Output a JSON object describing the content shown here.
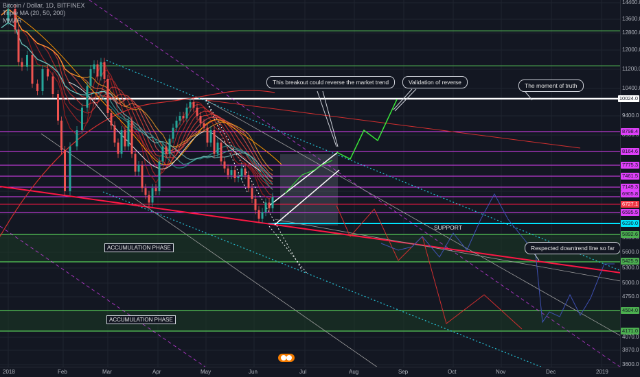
{
  "header": {
    "symbol_line": "Bitcoin / Dollar, 1D, BITFINEX",
    "indicator_line": "Triple MA (20, 50, 200)",
    "indicator_line2": "MMAR"
  },
  "colors": {
    "background": "#131722",
    "up_candle": "#26a69a",
    "down_candle": "#ef5350",
    "magenta_level": "#e040fb",
    "green_level": "#4caf50",
    "support_level": "#00e5ff",
    "resistance_white": "#ffffff",
    "trendline_red": "#ff1744",
    "projection_green": "#39e639",
    "projection_blue": "#3f51b5"
  },
  "annotations": {
    "breakout_callout": "This breakout could reverse the market trend",
    "validation_callout": "Validation of reverse",
    "truth_callout": "The moment of truth",
    "downtrend_callout": "Respected downtrend line so far",
    "support_label": "SUPPORT",
    "accumulation_1": "ACCUMULATION PHASE",
    "accumulation_2": "ACCUMULATION PHASE"
  },
  "chart_data": {
    "type": "line",
    "x_axis_labels": [
      "2018",
      "Feb",
      "Mar",
      "Apr",
      "May",
      "Jun",
      "Jul",
      "Aug",
      "Sep",
      "Oct",
      "Nov",
      "Dec",
      "2019"
    ],
    "price_axis_labels": [
      "14400.0",
      "13600.0",
      "12800.0",
      "12000.0",
      "11200.0",
      "10400.0",
      "9400.0",
      "8600.0",
      "7800.0",
      "7000.0",
      "6400.0",
      "5900.0",
      "5600.0",
      "5300.0",
      "5000.0",
      "4750.0",
      "4400.0",
      "4070.0",
      "3870.0",
      "3600.0"
    ],
    "price_tags": [
      {
        "label": "10024.0",
        "bg": "#ffffff",
        "fg": "#131722"
      },
      {
        "label": "8798.4",
        "bg": "#e040fb",
        "fg": "#131722"
      },
      {
        "label": "8164.6",
        "bg": "#e040fb",
        "fg": "#131722"
      },
      {
        "label": "7775.3",
        "bg": "#e040fb",
        "fg": "#131722"
      },
      {
        "label": "7461.5",
        "bg": "#e040fb",
        "fg": "#131722"
      },
      {
        "label": "7149.3",
        "bg": "#e040fb",
        "fg": "#131722"
      },
      {
        "label": "6905.8",
        "bg": "#e040fb",
        "fg": "#131722"
      },
      {
        "label": "6727.1",
        "bg": "#f23645",
        "fg": "#ffffff"
      },
      {
        "label": "6595.5",
        "bg": "#e040fb",
        "fg": "#131722"
      },
      {
        "label": "6230.0",
        "bg": "#00e5ff",
        "fg": "#131722"
      },
      {
        "label": "5892.6",
        "bg": "#4caf50",
        "fg": "#131722"
      },
      {
        "label": "5425.9",
        "bg": "#4caf50",
        "fg": "#131722"
      },
      {
        "label": "4504.0",
        "bg": "#4caf50",
        "fg": "#131722"
      },
      {
        "label": "4171.0",
        "bg": "#4caf50",
        "fg": "#131722"
      }
    ],
    "series": [
      {
        "name": "",
        "values": [
          [
            0,
            13500
          ],
          [
            4,
            14100
          ],
          [
            8,
            13000
          ],
          [
            10,
            11500
          ],
          [
            12,
            11300
          ],
          [
            15,
            11800
          ],
          [
            18,
            10600
          ],
          [
            21,
            10300
          ],
          [
            24,
            11200
          ],
          [
            27,
            10900
          ],
          [
            30,
            10200
          ],
          [
            33,
            9200
          ],
          [
            35,
            8200
          ],
          [
            37,
            7000
          ],
          [
            40,
            8300
          ],
          [
            44,
            8800
          ],
          [
            47,
            9700
          ],
          [
            50,
            10500
          ],
          [
            52,
            11200
          ],
          [
            54,
            11400
          ],
          [
            56,
            10900
          ],
          [
            58,
            11500
          ],
          [
            60,
            10800
          ],
          [
            62,
            9500
          ],
          [
            64,
            9000
          ],
          [
            66,
            8400
          ],
          [
            68,
            8100
          ],
          [
            70,
            8800
          ],
          [
            72,
            8300
          ],
          [
            74,
            9200
          ],
          [
            76,
            8100
          ],
          [
            78,
            7600
          ],
          [
            80,
            7800
          ],
          [
            82,
            7100
          ],
          [
            84,
            6900
          ],
          [
            86,
            6700
          ],
          [
            88,
            7100
          ],
          [
            90,
            7000
          ],
          [
            92,
            7900
          ],
          [
            94,
            8300
          ],
          [
            96,
            8100
          ],
          [
            98,
            8500
          ],
          [
            100,
            8900
          ],
          [
            102,
            9200
          ],
          [
            104,
            9400
          ],
          [
            106,
            9300
          ],
          [
            108,
            9700
          ],
          [
            110,
            9900
          ],
          [
            112,
            9700
          ],
          [
            114,
            9400
          ],
          [
            116,
            9100
          ],
          [
            118,
            8900
          ],
          [
            120,
            8400
          ],
          [
            122,
            8800
          ],
          [
            124,
            8100
          ],
          [
            126,
            8400
          ],
          [
            128,
            7900
          ],
          [
            130,
            7700
          ],
          [
            132,
            7500
          ],
          [
            134,
            7650
          ],
          [
            136,
            7400
          ],
          [
            138,
            7450
          ],
          [
            140,
            7700
          ],
          [
            142,
            7500
          ],
          [
            144,
            7100
          ],
          [
            146,
            6800
          ],
          [
            148,
            6500
          ],
          [
            150,
            6300
          ],
          [
            152,
            6450
          ],
          [
            154,
            6700
          ],
          [
            156,
            6550
          ],
          [
            158,
            6850
          ]
        ]
      }
    ],
    "grid": true,
    "legend_position": "top-left"
  }
}
